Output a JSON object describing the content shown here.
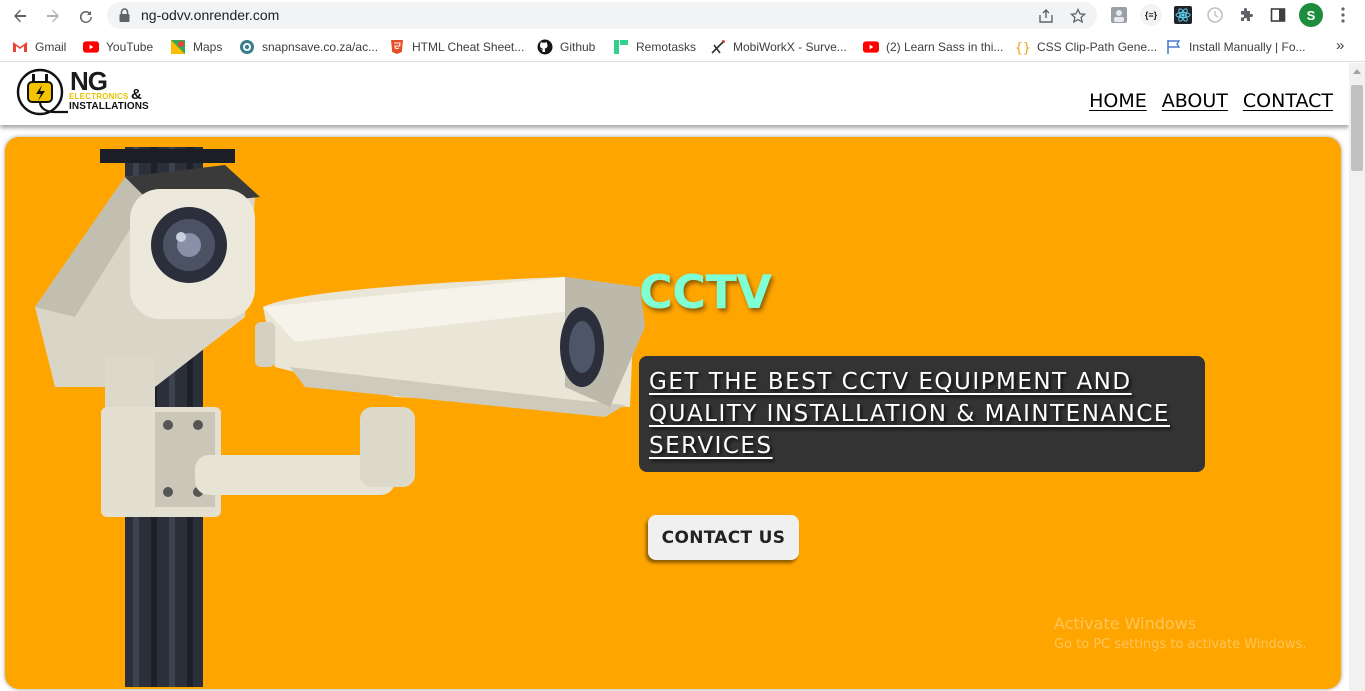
{
  "browser": {
    "url": "ng-odvv.onrender.com",
    "profile_initial": "S",
    "icons": {
      "back": "arrow-left-icon",
      "forward": "arrow-right-icon",
      "reload": "reload-icon",
      "lock": "lock-icon",
      "share": "share-icon",
      "star": "star-icon",
      "extensions": "puzzle-icon",
      "side_panel": "side-panel-icon",
      "menu": "kebab-menu-icon"
    },
    "extension_badge": "{≡}",
    "profile_color": "#1e8e3e",
    "bookmarks": [
      {
        "label": "Gmail",
        "icon": "gmail-icon"
      },
      {
        "label": "YouTube",
        "icon": "youtube-icon"
      },
      {
        "label": "Maps",
        "icon": "maps-icon"
      },
      {
        "label": "snapnsave.co.za/ac...",
        "icon": "snapnsave-icon"
      },
      {
        "label": "HTML Cheat Sheet...",
        "icon": "html-icon"
      },
      {
        "label": "Github",
        "icon": "github-icon"
      },
      {
        "label": "Remotasks",
        "icon": "remotasks-icon"
      },
      {
        "label": "MobiWorkX - Surve...",
        "icon": "mobiworkx-icon"
      },
      {
        "label": "(2) Learn Sass in thi...",
        "icon": "youtube-icon"
      },
      {
        "label": "CSS Clip-Path Gene...",
        "icon": "css-icon"
      },
      {
        "label": "Install Manually | Fo...",
        "icon": "flag-icon"
      }
    ],
    "bookmarks_overflow": "»"
  },
  "site": {
    "logo": {
      "ng": "NG",
      "electronics": "ELECTRONICS",
      "amp": "&",
      "installations": "INSTALLATIONS"
    },
    "nav": [
      {
        "label": "HOME"
      },
      {
        "label": "ABOUT"
      },
      {
        "label": "CONTACT"
      }
    ],
    "hero": {
      "title": "CCTV",
      "tagline": "GET THE BEST CCTV EQUIPMENT AND QUALITY INSTALLATION & MAINTENANCE SERVICES",
      "cta": "CONTACT US",
      "background_color": "#ffa500",
      "title_color": "#7fffd4"
    }
  },
  "watermark": {
    "line1": "Activate Windows",
    "line2": "Go to PC settings to activate Windows."
  }
}
